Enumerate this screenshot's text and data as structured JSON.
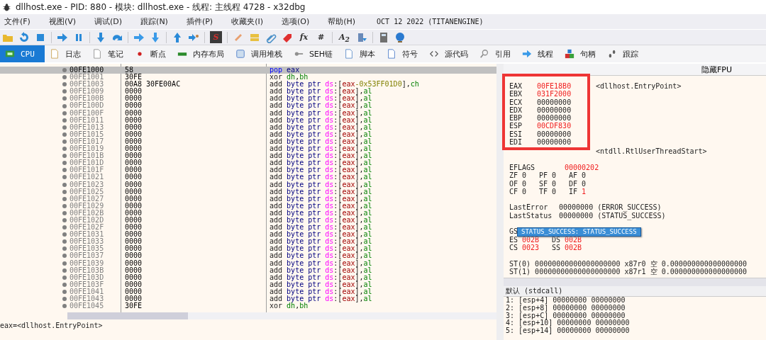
{
  "window": {
    "title": "dllhost.exe - PID: 880 - 模块: dllhost.exe - 线程: 主线程 4728 - x32dbg"
  },
  "menu": [
    "文件(F)",
    "视图(V)",
    "调试(D)",
    "跟踪(N)",
    "插件(P)",
    "收藏夹(I)",
    "选项(O)",
    "帮助(H)"
  ],
  "build_info": "OCT 12 2022 (TITANENGINE)",
  "toolbar_glyphs": [
    "S",
    "fx",
    "#",
    "A$_{2}$"
  ],
  "tabs": [
    {
      "label": "CPU",
      "selected": true
    },
    {
      "label": "日志",
      "selected": false
    },
    {
      "label": "笔记",
      "selected": false
    },
    {
      "label": "断点",
      "selected": false
    },
    {
      "label": "内存布局",
      "selected": false
    },
    {
      "label": "调用堆栈",
      "selected": false
    },
    {
      "label": "SEH链",
      "selected": false
    },
    {
      "label": "脚本",
      "selected": false
    },
    {
      "label": "符号",
      "selected": false
    },
    {
      "label": "源代码",
      "selected": false
    },
    {
      "label": "引用",
      "selected": false
    },
    {
      "label": "线程",
      "selected": false
    },
    {
      "label": "句柄",
      "selected": false
    },
    {
      "label": "跟踪",
      "selected": false
    }
  ],
  "disassembly": [
    {
      "address": "00FE1000",
      "bytes": "58",
      "selected": true,
      "asm": [
        {
          "text": "pop ",
          "kind": "stack"
        },
        {
          "text": "eax",
          "kind": "plainreg"
        }
      ]
    },
    {
      "address": "00FE1001",
      "bytes": "30FE",
      "selected": false,
      "asm": [
        {
          "text": "xor ",
          "kind": "mnemonic"
        },
        {
          "text": "dh",
          "kind": "reg"
        },
        {
          "text": ",",
          "kind": "punct"
        },
        {
          "text": "bh",
          "kind": "reg"
        }
      ]
    },
    {
      "address": "00FE1003",
      "bytes": "00A8",
      "operand": "30FE00AC",
      "selected": false,
      "asm": [
        {
          "text": "add ",
          "kind": "mnemonic"
        },
        {
          "text": "byte ptr ",
          "kind": "size"
        },
        {
          "text": "ds",
          "kind": "segment"
        },
        {
          "text": ":[",
          "kind": "punct"
        },
        {
          "text": "eax",
          "kind": "memreg"
        },
        {
          "text": "-0x53FF01D0",
          "kind": "number"
        },
        {
          "text": "],",
          "kind": "punct"
        },
        {
          "text": "ch",
          "kind": "reg"
        }
      ]
    },
    {
      "address": "00FE1009",
      "bytes": "0000",
      "selected": false,
      "asm": [
        {
          "text": "add ",
          "kind": "mnemonic"
        },
        {
          "text": "byte ptr ",
          "kind": "size"
        },
        {
          "text": "ds",
          "kind": "segment"
        },
        {
          "text": ":[",
          "kind": "punct"
        },
        {
          "text": "eax",
          "kind": "memreg"
        },
        {
          "text": "],",
          "kind": "punct"
        },
        {
          "text": "al",
          "kind": "reg"
        }
      ]
    },
    {
      "address": "00FE100B",
      "bytes": "0000",
      "selected": false,
      "asm": [
        {
          "text": "add ",
          "kind": "mnemonic"
        },
        {
          "text": "byte ptr ",
          "kind": "size"
        },
        {
          "text": "ds",
          "kind": "segment"
        },
        {
          "text": ":[",
          "kind": "punct"
        },
        {
          "text": "eax",
          "kind": "memreg"
        },
        {
          "text": "],",
          "kind": "punct"
        },
        {
          "text": "al",
          "kind": "reg"
        }
      ]
    },
    {
      "address": "00FE100D",
      "bytes": "0000",
      "selected": false,
      "asm": [
        {
          "text": "add ",
          "kind": "mnemonic"
        },
        {
          "text": "byte ptr ",
          "kind": "size"
        },
        {
          "text": "ds",
          "kind": "segment"
        },
        {
          "text": ":[",
          "kind": "punct"
        },
        {
          "text": "eax",
          "kind": "memreg"
        },
        {
          "text": "],",
          "kind": "punct"
        },
        {
          "text": "al",
          "kind": "reg"
        }
      ]
    },
    {
      "address": "00FE100F",
      "bytes": "0000",
      "selected": false,
      "asm": [
        {
          "text": "add ",
          "kind": "mnemonic"
        },
        {
          "text": "byte ptr ",
          "kind": "size"
        },
        {
          "text": "ds",
          "kind": "segment"
        },
        {
          "text": ":[",
          "kind": "punct"
        },
        {
          "text": "eax",
          "kind": "memreg"
        },
        {
          "text": "],",
          "kind": "punct"
        },
        {
          "text": "al",
          "kind": "reg"
        }
      ]
    },
    {
      "address": "00FE1011",
      "bytes": "0000",
      "selected": false,
      "asm": [
        {
          "text": "add ",
          "kind": "mnemonic"
        },
        {
          "text": "byte ptr ",
          "kind": "size"
        },
        {
          "text": "ds",
          "kind": "segment"
        },
        {
          "text": ":[",
          "kind": "punct"
        },
        {
          "text": "eax",
          "kind": "memreg"
        },
        {
          "text": "],",
          "kind": "punct"
        },
        {
          "text": "al",
          "kind": "reg"
        }
      ]
    },
    {
      "address": "00FE1013",
      "bytes": "0000",
      "selected": false,
      "asm": [
        {
          "text": "add ",
          "kind": "mnemonic"
        },
        {
          "text": "byte ptr ",
          "kind": "size"
        },
        {
          "text": "ds",
          "kind": "segment"
        },
        {
          "text": ":[",
          "kind": "punct"
        },
        {
          "text": "eax",
          "kind": "memreg"
        },
        {
          "text": "],",
          "kind": "punct"
        },
        {
          "text": "al",
          "kind": "reg"
        }
      ]
    },
    {
      "address": "00FE1015",
      "bytes": "0000",
      "selected": false,
      "asm": [
        {
          "text": "add ",
          "kind": "mnemonic"
        },
        {
          "text": "byte ptr ",
          "kind": "size"
        },
        {
          "text": "ds",
          "kind": "segment"
        },
        {
          "text": ":[",
          "kind": "punct"
        },
        {
          "text": "eax",
          "kind": "memreg"
        },
        {
          "text": "],",
          "kind": "punct"
        },
        {
          "text": "al",
          "kind": "reg"
        }
      ]
    },
    {
      "address": "00FE1017",
      "bytes": "0000",
      "selected": false,
      "asm": [
        {
          "text": "add ",
          "kind": "mnemonic"
        },
        {
          "text": "byte ptr ",
          "kind": "size"
        },
        {
          "text": "ds",
          "kind": "segment"
        },
        {
          "text": ":[",
          "kind": "punct"
        },
        {
          "text": "eax",
          "kind": "memreg"
        },
        {
          "text": "],",
          "kind": "punct"
        },
        {
          "text": "al",
          "kind": "reg"
        }
      ]
    },
    {
      "address": "00FE1019",
      "bytes": "0000",
      "selected": false,
      "asm": [
        {
          "text": "add ",
          "kind": "mnemonic"
        },
        {
          "text": "byte ptr ",
          "kind": "size"
        },
        {
          "text": "ds",
          "kind": "segment"
        },
        {
          "text": ":[",
          "kind": "punct"
        },
        {
          "text": "eax",
          "kind": "memreg"
        },
        {
          "text": "],",
          "kind": "punct"
        },
        {
          "text": "al",
          "kind": "reg"
        }
      ]
    },
    {
      "address": "00FE101B",
      "bytes": "0000",
      "selected": false,
      "asm": [
        {
          "text": "add ",
          "kind": "mnemonic"
        },
        {
          "text": "byte ptr ",
          "kind": "size"
        },
        {
          "text": "ds",
          "kind": "segment"
        },
        {
          "text": ":[",
          "kind": "punct"
        },
        {
          "text": "eax",
          "kind": "memreg"
        },
        {
          "text": "],",
          "kind": "punct"
        },
        {
          "text": "al",
          "kind": "reg"
        }
      ]
    },
    {
      "address": "00FE101D",
      "bytes": "0000",
      "selected": false,
      "asm": [
        {
          "text": "add ",
          "kind": "mnemonic"
        },
        {
          "text": "byte ptr ",
          "kind": "size"
        },
        {
          "text": "ds",
          "kind": "segment"
        },
        {
          "text": ":[",
          "kind": "punct"
        },
        {
          "text": "eax",
          "kind": "memreg"
        },
        {
          "text": "],",
          "kind": "punct"
        },
        {
          "text": "al",
          "kind": "reg"
        }
      ]
    },
    {
      "address": "00FE101F",
      "bytes": "0000",
      "selected": false,
      "asm": [
        {
          "text": "add ",
          "kind": "mnemonic"
        },
        {
          "text": "byte ptr ",
          "kind": "size"
        },
        {
          "text": "ds",
          "kind": "segment"
        },
        {
          "text": ":[",
          "kind": "punct"
        },
        {
          "text": "eax",
          "kind": "memreg"
        },
        {
          "text": "],",
          "kind": "punct"
        },
        {
          "text": "al",
          "kind": "reg"
        }
      ]
    },
    {
      "address": "00FE1021",
      "bytes": "0000",
      "selected": false,
      "asm": [
        {
          "text": "add ",
          "kind": "mnemonic"
        },
        {
          "text": "byte ptr ",
          "kind": "size"
        },
        {
          "text": "ds",
          "kind": "segment"
        },
        {
          "text": ":[",
          "kind": "punct"
        },
        {
          "text": "eax",
          "kind": "memreg"
        },
        {
          "text": "],",
          "kind": "punct"
        },
        {
          "text": "al",
          "kind": "reg"
        }
      ]
    },
    {
      "address": "00FE1023",
      "bytes": "0000",
      "selected": false,
      "asm": [
        {
          "text": "add ",
          "kind": "mnemonic"
        },
        {
          "text": "byte ptr ",
          "kind": "size"
        },
        {
          "text": "ds",
          "kind": "segment"
        },
        {
          "text": ":[",
          "kind": "punct"
        },
        {
          "text": "eax",
          "kind": "memreg"
        },
        {
          "text": "],",
          "kind": "punct"
        },
        {
          "text": "al",
          "kind": "reg"
        }
      ]
    },
    {
      "address": "00FE1025",
      "bytes": "0000",
      "selected": false,
      "asm": [
        {
          "text": "add ",
          "kind": "mnemonic"
        },
        {
          "text": "byte ptr ",
          "kind": "size"
        },
        {
          "text": "ds",
          "kind": "segment"
        },
        {
          "text": ":[",
          "kind": "punct"
        },
        {
          "text": "eax",
          "kind": "memreg"
        },
        {
          "text": "],",
          "kind": "punct"
        },
        {
          "text": "al",
          "kind": "reg"
        }
      ]
    },
    {
      "address": "00FE1027",
      "bytes": "0000",
      "selected": false,
      "asm": [
        {
          "text": "add ",
          "kind": "mnemonic"
        },
        {
          "text": "byte ptr ",
          "kind": "size"
        },
        {
          "text": "ds",
          "kind": "segment"
        },
        {
          "text": ":[",
          "kind": "punct"
        },
        {
          "text": "eax",
          "kind": "memreg"
        },
        {
          "text": "],",
          "kind": "punct"
        },
        {
          "text": "al",
          "kind": "reg"
        }
      ]
    },
    {
      "address": "00FE1029",
      "bytes": "0000",
      "selected": false,
      "asm": [
        {
          "text": "add ",
          "kind": "mnemonic"
        },
        {
          "text": "byte ptr ",
          "kind": "size"
        },
        {
          "text": "ds",
          "kind": "segment"
        },
        {
          "text": ":[",
          "kind": "punct"
        },
        {
          "text": "eax",
          "kind": "memreg"
        },
        {
          "text": "],",
          "kind": "punct"
        },
        {
          "text": "al",
          "kind": "reg"
        }
      ]
    },
    {
      "address": "00FE102B",
      "bytes": "0000",
      "selected": false,
      "asm": [
        {
          "text": "add ",
          "kind": "mnemonic"
        },
        {
          "text": "byte ptr ",
          "kind": "size"
        },
        {
          "text": "ds",
          "kind": "segment"
        },
        {
          "text": ":[",
          "kind": "punct"
        },
        {
          "text": "eax",
          "kind": "memreg"
        },
        {
          "text": "],",
          "kind": "punct"
        },
        {
          "text": "al",
          "kind": "reg"
        }
      ]
    },
    {
      "address": "00FE102D",
      "bytes": "0000",
      "selected": false,
      "asm": [
        {
          "text": "add ",
          "kind": "mnemonic"
        },
        {
          "text": "byte ptr ",
          "kind": "size"
        },
        {
          "text": "ds",
          "kind": "segment"
        },
        {
          "text": ":[",
          "kind": "punct"
        },
        {
          "text": "eax",
          "kind": "memreg"
        },
        {
          "text": "],",
          "kind": "punct"
        },
        {
          "text": "al",
          "kind": "reg"
        }
      ]
    },
    {
      "address": "00FE102F",
      "bytes": "0000",
      "selected": false,
      "asm": [
        {
          "text": "add ",
          "kind": "mnemonic"
        },
        {
          "text": "byte ptr ",
          "kind": "size"
        },
        {
          "text": "ds",
          "kind": "segment"
        },
        {
          "text": ":[",
          "kind": "punct"
        },
        {
          "text": "eax",
          "kind": "memreg"
        },
        {
          "text": "],",
          "kind": "punct"
        },
        {
          "text": "al",
          "kind": "reg"
        }
      ]
    },
    {
      "address": "00FE1031",
      "bytes": "0000",
      "selected": false,
      "asm": [
        {
          "text": "add ",
          "kind": "mnemonic"
        },
        {
          "text": "byte ptr ",
          "kind": "size"
        },
        {
          "text": "ds",
          "kind": "segment"
        },
        {
          "text": ":[",
          "kind": "punct"
        },
        {
          "text": "eax",
          "kind": "memreg"
        },
        {
          "text": "],",
          "kind": "punct"
        },
        {
          "text": "al",
          "kind": "reg"
        }
      ]
    },
    {
      "address": "00FE1033",
      "bytes": "0000",
      "selected": false,
      "asm": [
        {
          "text": "add ",
          "kind": "mnemonic"
        },
        {
          "text": "byte ptr ",
          "kind": "size"
        },
        {
          "text": "ds",
          "kind": "segment"
        },
        {
          "text": ":[",
          "kind": "punct"
        },
        {
          "text": "eax",
          "kind": "memreg"
        },
        {
          "text": "],",
          "kind": "punct"
        },
        {
          "text": "al",
          "kind": "reg"
        }
      ]
    },
    {
      "address": "00FE1035",
      "bytes": "0000",
      "selected": false,
      "asm": [
        {
          "text": "add ",
          "kind": "mnemonic"
        },
        {
          "text": "byte ptr ",
          "kind": "size"
        },
        {
          "text": "ds",
          "kind": "segment"
        },
        {
          "text": ":[",
          "kind": "punct"
        },
        {
          "text": "eax",
          "kind": "memreg"
        },
        {
          "text": "],",
          "kind": "punct"
        },
        {
          "text": "al",
          "kind": "reg"
        }
      ]
    },
    {
      "address": "00FE1037",
      "bytes": "0000",
      "selected": false,
      "asm": [
        {
          "text": "add ",
          "kind": "mnemonic"
        },
        {
          "text": "byte ptr ",
          "kind": "size"
        },
        {
          "text": "ds",
          "kind": "segment"
        },
        {
          "text": ":[",
          "kind": "punct"
        },
        {
          "text": "eax",
          "kind": "memreg"
        },
        {
          "text": "],",
          "kind": "punct"
        },
        {
          "text": "al",
          "kind": "reg"
        }
      ]
    },
    {
      "address": "00FE1039",
      "bytes": "0000",
      "selected": false,
      "asm": [
        {
          "text": "add ",
          "kind": "mnemonic"
        },
        {
          "text": "byte ptr ",
          "kind": "size"
        },
        {
          "text": "ds",
          "kind": "segment"
        },
        {
          "text": ":[",
          "kind": "punct"
        },
        {
          "text": "eax",
          "kind": "memreg"
        },
        {
          "text": "],",
          "kind": "punct"
        },
        {
          "text": "al",
          "kind": "reg"
        }
      ]
    },
    {
      "address": "00FE103B",
      "bytes": "0000",
      "selected": false,
      "asm": [
        {
          "text": "add ",
          "kind": "mnemonic"
        },
        {
          "text": "byte ptr ",
          "kind": "size"
        },
        {
          "text": "ds",
          "kind": "segment"
        },
        {
          "text": ":[",
          "kind": "punct"
        },
        {
          "text": "eax",
          "kind": "memreg"
        },
        {
          "text": "],",
          "kind": "punct"
        },
        {
          "text": "al",
          "kind": "reg"
        }
      ]
    },
    {
      "address": "00FE103D",
      "bytes": "0000",
      "selected": false,
      "asm": [
        {
          "text": "add ",
          "kind": "mnemonic"
        },
        {
          "text": "byte ptr ",
          "kind": "size"
        },
        {
          "text": "ds",
          "kind": "segment"
        },
        {
          "text": ":[",
          "kind": "punct"
        },
        {
          "text": "eax",
          "kind": "memreg"
        },
        {
          "text": "],",
          "kind": "punct"
        },
        {
          "text": "al",
          "kind": "reg"
        }
      ]
    },
    {
      "address": "00FE103F",
      "bytes": "0000",
      "selected": false,
      "asm": [
        {
          "text": "add ",
          "kind": "mnemonic"
        },
        {
          "text": "byte ptr ",
          "kind": "size"
        },
        {
          "text": "ds",
          "kind": "segment"
        },
        {
          "text": ":[",
          "kind": "punct"
        },
        {
          "text": "eax",
          "kind": "memreg"
        },
        {
          "text": "],",
          "kind": "punct"
        },
        {
          "text": "al",
          "kind": "reg"
        }
      ]
    },
    {
      "address": "00FE1041",
      "bytes": "0000",
      "selected": false,
      "asm": [
        {
          "text": "add ",
          "kind": "mnemonic"
        },
        {
          "text": "byte ptr ",
          "kind": "size"
        },
        {
          "text": "ds",
          "kind": "segment"
        },
        {
          "text": ":[",
          "kind": "punct"
        },
        {
          "text": "eax",
          "kind": "memreg"
        },
        {
          "text": "],",
          "kind": "punct"
        },
        {
          "text": "al",
          "kind": "reg"
        }
      ]
    },
    {
      "address": "00FE1043",
      "bytes": "0000",
      "selected": false,
      "asm": [
        {
          "text": "add ",
          "kind": "mnemonic"
        },
        {
          "text": "byte ptr ",
          "kind": "size"
        },
        {
          "text": "ds",
          "kind": "segment"
        },
        {
          "text": ":[",
          "kind": "punct"
        },
        {
          "text": "eax",
          "kind": "memreg"
        },
        {
          "text": "],",
          "kind": "punct"
        },
        {
          "text": "al",
          "kind": "reg"
        }
      ]
    },
    {
      "address": "00FE1045",
      "bytes": "30FE",
      "selected": false,
      "asm": [
        {
          "text": "xor ",
          "kind": "mnemonic"
        },
        {
          "text": "dh",
          "kind": "reg"
        },
        {
          "text": ",",
          "kind": "punct"
        },
        {
          "text": "bh",
          "kind": "reg"
        }
      ]
    }
  ],
  "status_text": "eax=<dllhost.EntryPoint>",
  "registers_panel": {
    "hide_fpu_button": "隐藏FPU",
    "registers": [
      {
        "name": "EAX",
        "value": "00FE18B0",
        "modified": true,
        "comment": "<dllhost.EntryPoint>"
      },
      {
        "name": "EBX",
        "value": "031F2000",
        "modified": true
      },
      {
        "name": "ECX",
        "value": "00000000",
        "modified": false
      },
      {
        "name": "EDX",
        "value": "00000000",
        "modified": false
      },
      {
        "name": "EBP",
        "value": "00000000",
        "modified": false
      },
      {
        "name": "ESP",
        "value": "00CDF830",
        "modified": true
      },
      {
        "name": "ESI",
        "value": "00000000",
        "modified": false
      },
      {
        "name": "EDI",
        "value": "00000000",
        "modified": false
      }
    ],
    "eip_comment": "<ntdll.RtlUserThreadStart>",
    "eflags": {
      "name": "EFLAGS",
      "value": "00000202",
      "modified": true
    },
    "flag_rows": [
      [
        {
          "name": "ZF",
          "value": "0",
          "modified": false
        },
        {
          "name": "PF",
          "value": "0",
          "modified": false
        },
        {
          "name": "AF",
          "value": "0",
          "modified": false
        }
      ],
      [
        {
          "name": "OF",
          "value": "0",
          "modified": false
        },
        {
          "name": "SF",
          "value": "0",
          "modified": false
        },
        {
          "name": "DF",
          "value": "0",
          "modified": false
        }
      ],
      [
        {
          "name": "CF",
          "value": "0",
          "modified": false
        },
        {
          "name": "TF",
          "value": "0",
          "modified": false
        },
        {
          "name": "IF",
          "value": "1",
          "modified": true
        }
      ]
    ],
    "last": [
      {
        "label": "LastError",
        "value": "00000000",
        "description": "(ERROR_SUCCESS)"
      },
      {
        "label": "LastStatus",
        "value": "00000000",
        "description": "(STATUS_SUCCESS)"
      }
    ],
    "segment_rows": [
      [
        {
          "name": "GS"
        }
      ],
      [
        {
          "name": "ES",
          "value": "002B",
          "modified": true
        },
        {
          "name": "DS",
          "value": "002B",
          "modified": true
        }
      ],
      [
        {
          "name": "CS",
          "value": "0023",
          "modified": true
        },
        {
          "name": "SS",
          "value": "002B",
          "modified": true
        }
      ]
    ],
    "tooltip": "STATUS_SUCCESS: STATUS_SUCCESS",
    "fpu": [
      {
        "name": "ST(0)",
        "raw": "00000000000000000000",
        "tag_register": "x87r0",
        "tag": "空",
        "value": "0.000000000000000000"
      },
      {
        "name": "ST(1)",
        "raw": "00000000000000000000",
        "tag_register": "x87r1",
        "tag": "空",
        "value": "0.000000000000000000"
      }
    ]
  },
  "call_arguments": {
    "convention": "默认 (stdcall)",
    "rows": [
      "1: [esp+4] 00000000 00000000",
      "2: [esp+8] 00000000 00000000",
      "3: [esp+C] 00000000 00000000",
      "4: [esp+10] 00000000 00000000",
      "5: [esp+14] 00000000 00000000"
    ]
  }
}
